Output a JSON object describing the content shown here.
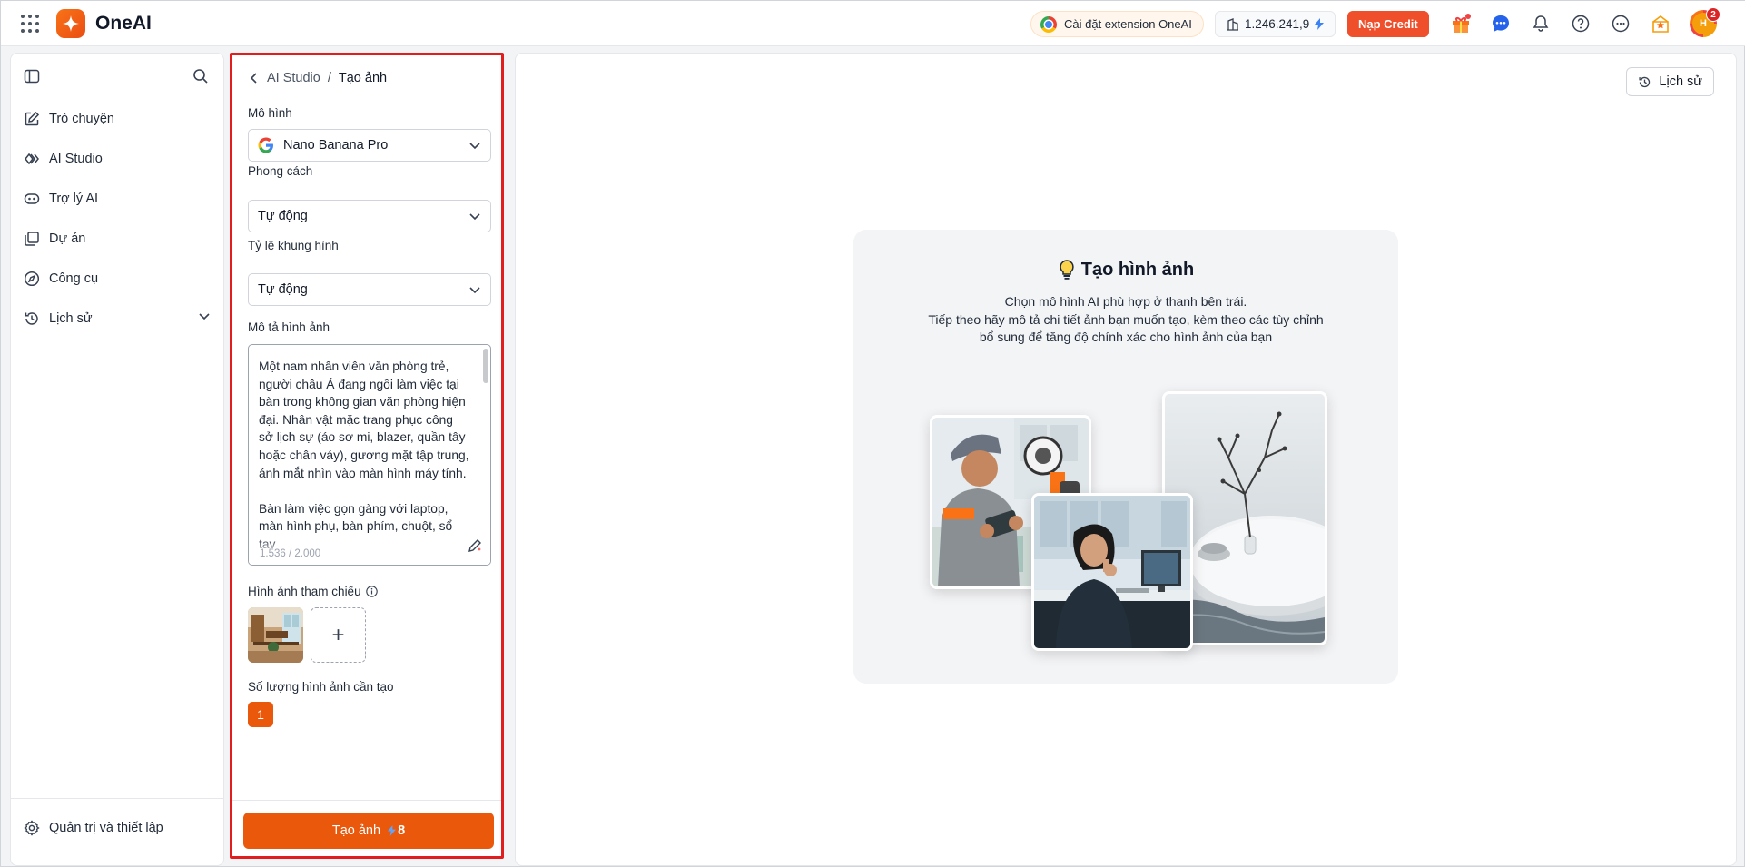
{
  "app": {
    "name": "OneAI"
  },
  "topbar": {
    "extension_label": "Cài đặt extension OneAI",
    "credits": "1.246.241,9",
    "topup_label": "Nạp Credit",
    "avatar_initials": "H",
    "notification_count": "2"
  },
  "sidebar": {
    "items": [
      {
        "label": "Trò chuyện",
        "icon": "edit-icon"
      },
      {
        "label": "AI Studio",
        "icon": "studio-icon"
      },
      {
        "label": "Trợ lý AI",
        "icon": "bot-icon"
      },
      {
        "label": "Dự án",
        "icon": "folder-icon"
      },
      {
        "label": "Công cụ",
        "icon": "compass-icon"
      },
      {
        "label": "Lịch sử",
        "icon": "history-icon"
      }
    ],
    "settings_label": "Quản trị và thiết lập"
  },
  "panel": {
    "breadcrumb_parent": "AI Studio",
    "breadcrumb_sep": "/",
    "breadcrumb_current": "Tạo ảnh",
    "model_label": "Mô hình",
    "model_value": "Nano Banana Pro",
    "style_label": "Phong cách",
    "style_value": "Tự động",
    "ratio_label": "Tỷ lệ khung hình",
    "ratio_value": "Tự động",
    "prompt_label": "Mô tả hình ảnh",
    "prompt_value": "Một nam nhân viên văn phòng trẻ, người châu Á đang ngồi làm việc tại bàn trong không gian văn phòng hiện đại. Nhân vật mặc trang phục công sở lịch sự (áo sơ mi, blazer, quần tây hoặc chân váy), gương mặt tập trung, ánh mắt nhìn vào màn hình máy tính.\n\nBàn làm việc gọn gàng với laptop, màn hình phụ, bàn phím, chuột, sổ tay",
    "prompt_count": "1.536 / 2.000",
    "reference_label": "Hình ảnh tham chiếu",
    "add_symbol": "+",
    "quantity_label": "Số lượng hình ảnh cần tạo",
    "quantity_value": "1",
    "generate_label": "Tạo ảnh",
    "generate_cost": "8"
  },
  "main": {
    "history_label": "Lịch sử",
    "empty_title": "Tạo hình ảnh",
    "empty_desc_1": "Chọn mô hình AI phù hợp ở thanh bên trái.",
    "empty_desc_2": "Tiếp theo hãy mô tả chi tiết ảnh bạn muốn tạo, kèm theo các tùy chỉnh",
    "empty_desc_3": "bổ sung để tăng độ chính xác cho hình ảnh của bạn"
  },
  "colors": {
    "accent": "#ea580c",
    "highlight_border": "#e11d1d"
  }
}
